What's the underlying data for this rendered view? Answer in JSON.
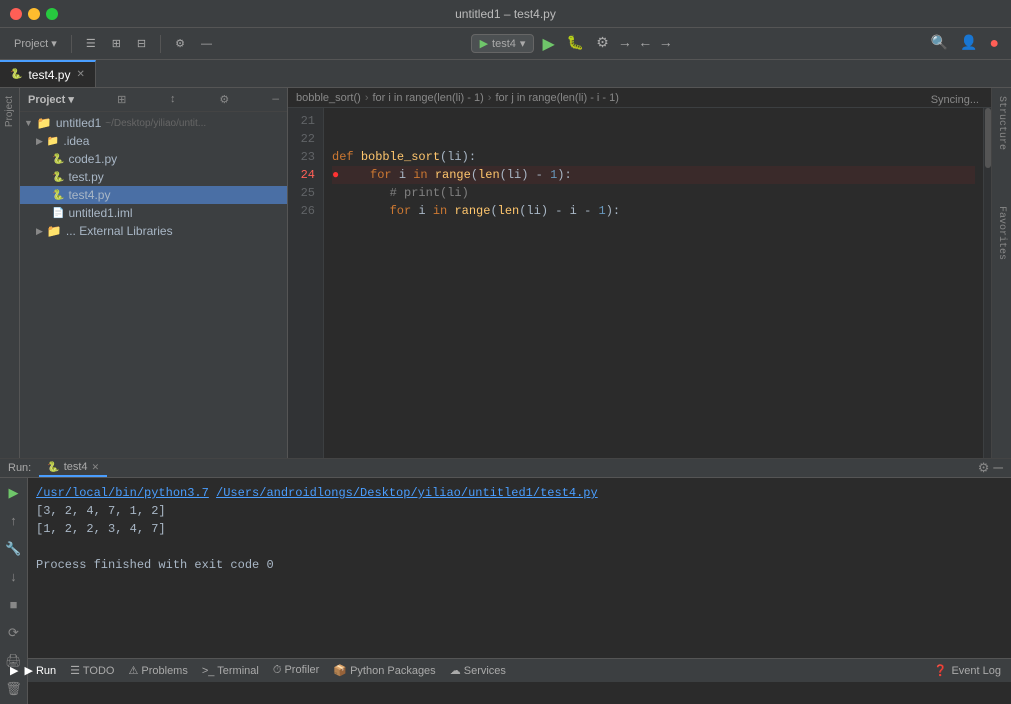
{
  "window": {
    "title": "untitled1 – test4.py"
  },
  "toolbar": {
    "project_label": "Project",
    "run_config_label": "test4",
    "search_icon": "🔍",
    "settings_icon": "⚙",
    "syncing_text": "Syncing..."
  },
  "tabs": [
    {
      "label": "test4.py",
      "active": true,
      "icon": "py"
    }
  ],
  "breadcrumb": {
    "parts": [
      "bobble_sort()",
      "for i in range(len(li) - 1)",
      "for j in range(len(li) - i - 1)"
    ]
  },
  "project_tree": {
    "root": "untitled1",
    "root_path": "~/Desktop/yiliao/untit...",
    "items": [
      {
        "label": ".idea",
        "indent": 1,
        "type": "folder",
        "expanded": false
      },
      {
        "label": "code1.py",
        "indent": 2,
        "type": "py"
      },
      {
        "label": "test.py",
        "indent": 2,
        "type": "py"
      },
      {
        "label": "test4.py",
        "indent": 2,
        "type": "py",
        "selected": true
      },
      {
        "label": "untitled1.iml",
        "indent": 2,
        "type": "iml"
      },
      {
        "label": "... External Libraries",
        "indent": 1,
        "type": "folder"
      }
    ]
  },
  "editor": {
    "lines": [
      {
        "num": "21",
        "content": ""
      },
      {
        "num": "22",
        "content": ""
      },
      {
        "num": "23",
        "content": "def bobble_sort(li):",
        "has_breakpoint": false
      },
      {
        "num": "24",
        "content": "    for i in range(len(li) - 1):",
        "has_breakpoint": true
      },
      {
        "num": "25",
        "content": "        # print(li)",
        "has_breakpoint": false
      },
      {
        "num": "26",
        "content": "        for i in range(len(li) - i - 1):",
        "has_breakpoint": false
      }
    ]
  },
  "run_panel": {
    "label": "Run:",
    "tab_label": "test4",
    "output_line1": "/usr/local/bin/python3.7 /Users/androidlongs/Desktop/yiliao/untitled1/test4.py",
    "output_line2": "[3, 2, 4, 7, 1, 2]",
    "output_line3": "[1, 2, 2, 3, 4, 7]",
    "output_line4": "",
    "output_line5": "Process finished with exit code 0"
  },
  "bottom_bar": {
    "run_label": "▶ Run",
    "todo_label": "☰ TODO",
    "problems_label": "⚠ Problems",
    "terminal_label": "> Terminal",
    "profiler_label": "⏱ Profiler",
    "python_packages_label": "📦 Python Packages",
    "services_label": "☁ Services",
    "event_log_label": "❓ Event Log"
  },
  "left_panel": {
    "project_label": "Project",
    "structure_label": "Structure",
    "favorites_label": "Favorites"
  },
  "colors": {
    "accent_blue": "#4a9eff",
    "run_green": "#6fc66a",
    "keyword_orange": "#cc7832",
    "fn_yellow": "#ffc66d",
    "comment_gray": "#808080",
    "num_blue": "#6897bb",
    "breakpoint_red": "#ff3333",
    "link_blue": "#4a9eff"
  }
}
